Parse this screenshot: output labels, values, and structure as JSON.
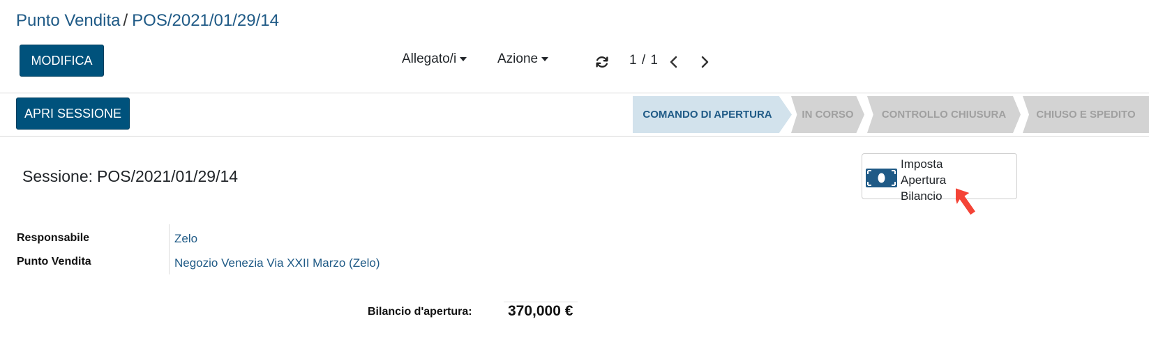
{
  "breadcrumb": {
    "parent": "Punto Vendita",
    "separator": "/",
    "current": "POS/2021/01/29/14"
  },
  "toolbar": {
    "edit_label": "MODIFICA",
    "attachments_label": "Allegato/i",
    "action_label": "Azione",
    "pager": "1 / 1"
  },
  "statusbar": {
    "open_session_label": "APRI SESSIONE",
    "stages": [
      {
        "label": "COMANDO DI APERTURA",
        "active": true
      },
      {
        "label": "IN CORSO",
        "active": false
      },
      {
        "label": "CONTROLLO CHIUSURA",
        "active": false
      },
      {
        "label": "CHIUSO E SPEDITO",
        "active": false
      }
    ]
  },
  "form": {
    "session_label": "Sessione:",
    "session_name": "POS/2021/01/29/14",
    "smart_button": {
      "icon": "money-icon",
      "lines": [
        "Imposta",
        "Apertura",
        "Bilancio"
      ]
    },
    "fields": {
      "responsible_label": "Responsabile",
      "responsible_value": "Zelo",
      "pos_label": "Punto Vendita",
      "pos_value": "Negozio Venezia Via XXII Marzo (Zelo)"
    },
    "balance": {
      "label": "Bilancio d'apertura:",
      "value": "370,000 €"
    }
  },
  "colors": {
    "primary": "#00527c",
    "link": "#1f5a86",
    "stage_active_bg": "#d2e2ec",
    "stage_inactive_bg": "#d3d3d3",
    "cursor": "#f44336"
  }
}
